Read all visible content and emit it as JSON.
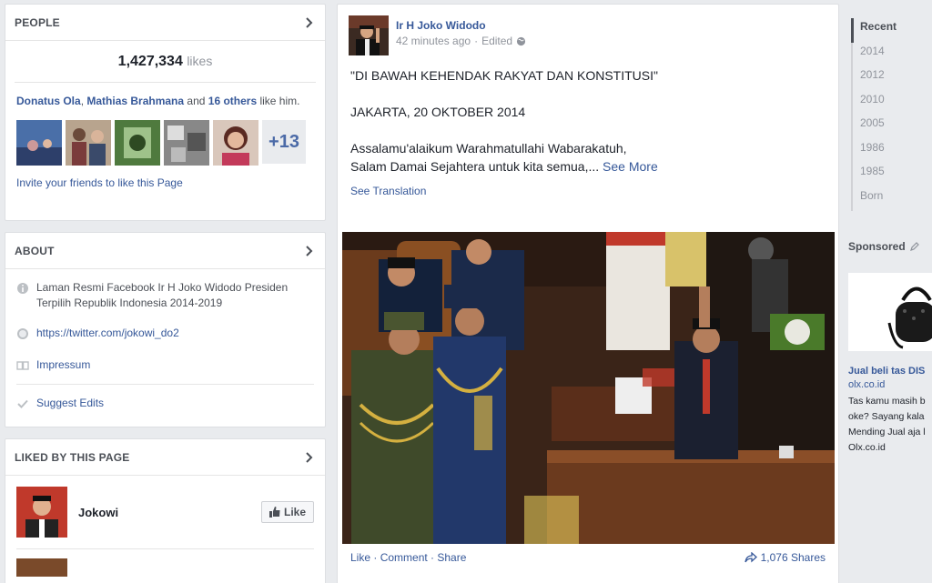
{
  "people": {
    "title": "PEOPLE",
    "likes_count": "1,427,334",
    "likes_word": "likes",
    "friend1": "Donatus Ola",
    "sep1": ", ",
    "friend2": "Mathias Brahmana",
    "and_text": " and ",
    "others": "16 others",
    "like_him": " like him.",
    "more_count": "+13",
    "invite": "Invite your friends to like this Page"
  },
  "about": {
    "title": "ABOUT",
    "description": "Laman Resmi Facebook Ir H Joko Widodo Presiden Terpilih Republik Indonesia 2014-2019",
    "twitter": "https://twitter.com/jokowi_do2",
    "impressum": "Impressum",
    "suggest": "Suggest Edits"
  },
  "liked": {
    "title": "LIKED BY THIS PAGE",
    "page_name": "Jokowi",
    "like_btn": "Like"
  },
  "post": {
    "author": "Ir H Joko Widodo",
    "time": "42 minutes ago",
    "edited": "Edited",
    "line1": "\"DI BAWAH KEHENDAK RAKYAT DAN KONSTITUSI\"",
    "line2": "JAKARTA, 20 OKTOBER 2014",
    "line3": "Assalamu'alaikum Warahmatullahi Wabarakatuh,",
    "line4": "Salam Damai Sejahtera untuk kita semua,...",
    "see_more": "See More",
    "see_translation": "See Translation",
    "like": "Like",
    "comment": "Comment",
    "share": "Share",
    "shares": "1,076 Shares"
  },
  "timeline": {
    "years": [
      "Recent",
      "2014",
      "2012",
      "2010",
      "2005",
      "1986",
      "1985",
      "Born"
    ]
  },
  "ad": {
    "sponsored": "Sponsored",
    "title": "Jual beli tas DIS",
    "domain": "olx.co.id",
    "text1": "Tas kamu masih b",
    "text2": "oke? Sayang kala",
    "text3": "Mending Jual aja l",
    "text4": "Olx.co.id"
  },
  "colors": {
    "link": "#365899",
    "bg": "#e9ebee"
  }
}
